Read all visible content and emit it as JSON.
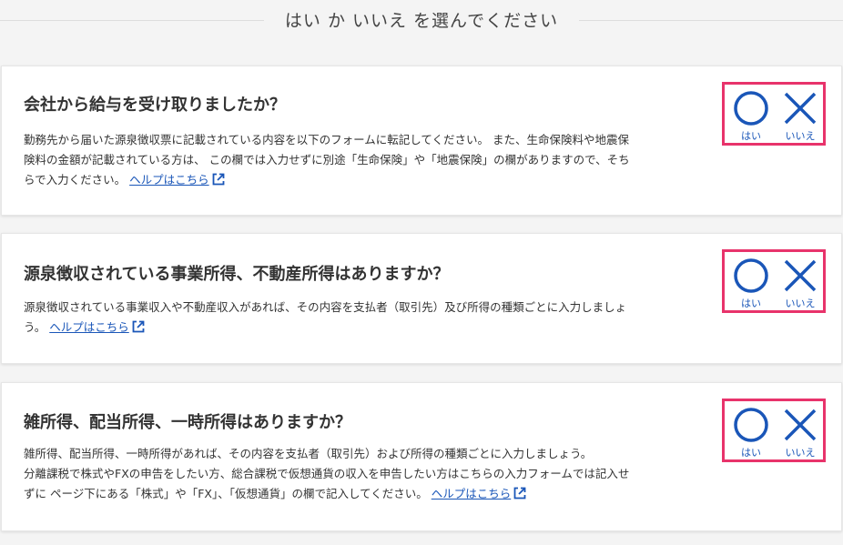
{
  "header": {
    "title": "はい か いいえ を選んでください"
  },
  "colors": {
    "accent_blue": "#1a56b8",
    "highlight_pink": "#e8336b"
  },
  "questions": [
    {
      "title": "会社から給与を受け取りましたか？",
      "desc_lines": [
        "勤務先から届いた源泉徴収票に記載されている内容を以下のフォームに転記してください。 また、生命保険料や地震保",
        "険料の金額が記載されている方は、 この欄では入力せずに別途「生命保険」や「地震保険」の欄がありますので、そち",
        "らで入力ください。"
      ],
      "help_label": "ヘルプはこちら",
      "yes_label": "はい",
      "no_label": "いいえ"
    },
    {
      "title": "源泉徴収されている事業所得、不動産所得はありますか？",
      "desc_lines": [
        "源泉徴収されている事業収入や不動産収入があれば、その内容を支払者（取引先）及び所得の種類ごとに入力しましょ",
        "う。"
      ],
      "help_label": "ヘルプはこちら",
      "yes_label": "はい",
      "no_label": "いいえ"
    },
    {
      "title": "雑所得、配当所得、一時所得はありますか？",
      "desc_lines": [
        "雑所得、配当所得、一時所得があれば、その内容を支払者（取引先）および所得の種類ごとに入力しましょう。",
        "分離課税で株式やFXの申告をしたい方、総合課税で仮想通貨の収入を申告したい方はこちらの入力フォームでは記入せ",
        "ずに ページ下にある「株式」や「FX」、「仮想通貨」の欄で記入してください。"
      ],
      "help_label": "ヘルプはこちら",
      "yes_label": "はい",
      "no_label": "いいえ"
    }
  ]
}
